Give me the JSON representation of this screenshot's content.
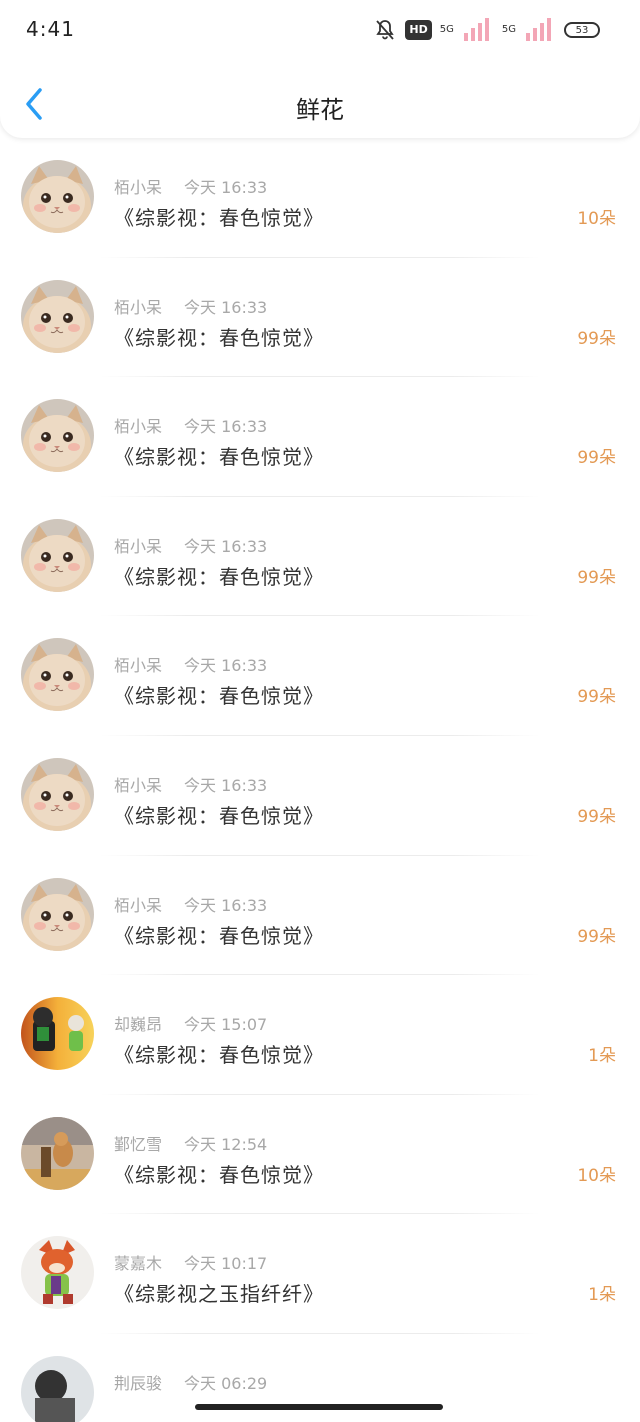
{
  "status_bar": {
    "time": "4:41",
    "hd": "HD",
    "net1": "5G",
    "net2": "5G",
    "battery": "53"
  },
  "header": {
    "title": "鲜花"
  },
  "rows": [
    {
      "name": "栢小呆",
      "time": "今天 16:33",
      "book": "《综影视：春色惊觉》",
      "flowers": "10朵",
      "avatar": "cat-avatar"
    },
    {
      "name": "栢小呆",
      "time": "今天 16:33",
      "book": "《综影视：春色惊觉》",
      "flowers": "99朵",
      "avatar": "cat-avatar"
    },
    {
      "name": "栢小呆",
      "time": "今天 16:33",
      "book": "《综影视：春色惊觉》",
      "flowers": "99朵",
      "avatar": "cat-avatar"
    },
    {
      "name": "栢小呆",
      "time": "今天 16:33",
      "book": "《综影视：春色惊觉》",
      "flowers": "99朵",
      "avatar": "cat-avatar"
    },
    {
      "name": "栢小呆",
      "time": "今天 16:33",
      "book": "《综影视：春色惊觉》",
      "flowers": "99朵",
      "avatar": "cat-avatar"
    },
    {
      "name": "栢小呆",
      "time": "今天 16:33",
      "book": "《综影视：春色惊觉》",
      "flowers": "99朵",
      "avatar": "cat-avatar"
    },
    {
      "name": "栢小呆",
      "time": "今天 16:33",
      "book": "《综影视：春色惊觉》",
      "flowers": "99朵",
      "avatar": "cat-avatar"
    },
    {
      "name": "却巍昂",
      "time": "今天 15:07",
      "book": "《综影视：春色惊觉》",
      "flowers": "1朵",
      "avatar": "figurine-avatar"
    },
    {
      "name": "鄞忆雪",
      "time": "今天 12:54",
      "book": "《综影视：春色惊觉》",
      "flowers": "10朵",
      "avatar": "squirrel-avatar"
    },
    {
      "name": "蒙嘉木",
      "time": "今天 10:17",
      "book": "《综影视之玉指纤纤》",
      "flowers": "1朵",
      "avatar": "fox-avatar"
    },
    {
      "name": "荆辰骏",
      "time": "今天 06:29",
      "book": "",
      "flowers": "",
      "avatar": "photo-avatar"
    }
  ]
}
